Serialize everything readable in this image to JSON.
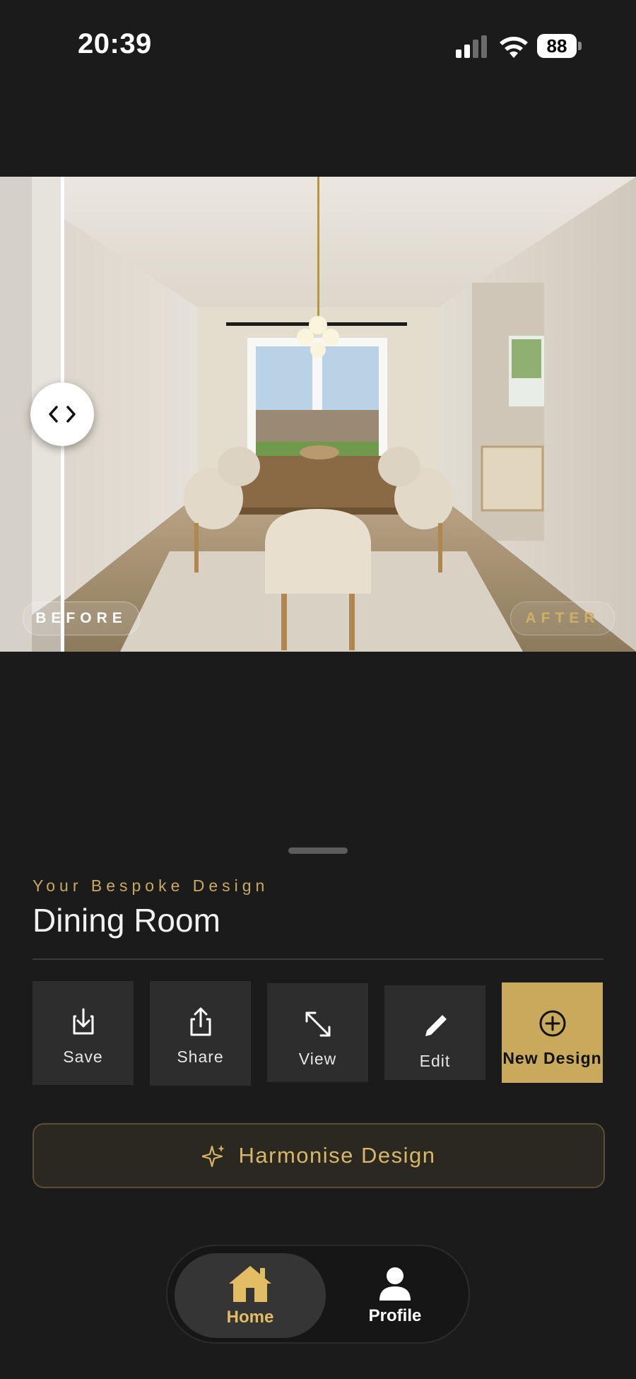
{
  "status_bar": {
    "time": "20:39",
    "battery": "88"
  },
  "compare": {
    "before_label": "BEFORE",
    "after_label": "AFTER",
    "handle_glyph": "‹ ›"
  },
  "design": {
    "kicker": "Your Bespoke Design",
    "room_name": "Dining Room"
  },
  "actions": [
    {
      "label": "Save",
      "icon": "download-icon"
    },
    {
      "label": "Share",
      "icon": "share-icon"
    },
    {
      "label": "View",
      "icon": "expand-icon"
    },
    {
      "label": "Edit",
      "icon": "pencil-icon"
    },
    {
      "label": "New Design",
      "icon": "plus-circle-icon"
    }
  ],
  "harmonise": {
    "label": "Harmonise Design",
    "icon": "sparkle-icon"
  },
  "tabbar": {
    "home": "Home",
    "profile": "Profile"
  },
  "colors": {
    "background": "#1b1b1b",
    "gold": "#c9a95c",
    "tile": "#2d2d2d"
  }
}
